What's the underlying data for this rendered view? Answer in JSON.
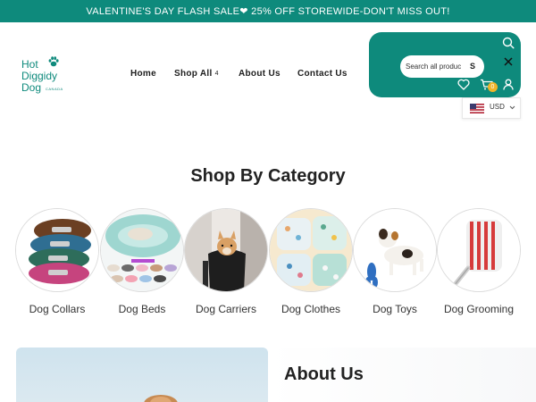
{
  "announcement": {
    "text": "VALENTINE'S DAY FLASH SALE❤ 25% OFF STOREWIDE-DON'T MISS OUT!"
  },
  "logo": {
    "line1": "Hot",
    "line2": "Diggidy",
    "line3": "Dog",
    "sub": "CANADA"
  },
  "nav": {
    "items": [
      {
        "label": "Home"
      },
      {
        "label": "Shop All",
        "caret": "4"
      },
      {
        "label": "About Us"
      },
      {
        "label": "Contact Us"
      }
    ]
  },
  "search": {
    "placeholder": "Search all products",
    "button_label": "S"
  },
  "cart": {
    "count": "0"
  },
  "currency": {
    "code": "USD"
  },
  "categories": {
    "title": "Shop By Category",
    "items": [
      {
        "label": "Dog Collars"
      },
      {
        "label": "Dog Beds"
      },
      {
        "label": "Dog Carriers"
      },
      {
        "label": "Dog Clothes"
      },
      {
        "label": "Dog Toys"
      },
      {
        "label": "Dog Grooming"
      }
    ]
  },
  "about": {
    "title": "About Us"
  },
  "colors": {
    "brand": "#0e8a7c",
    "badge": "#f0b429",
    "text": "#1d1d1d"
  },
  "icons": [
    "paw-icon",
    "search-icon",
    "close-icon",
    "heart-icon",
    "cart-icon",
    "user-icon",
    "us-flag-icon",
    "chevron-down-icon"
  ]
}
